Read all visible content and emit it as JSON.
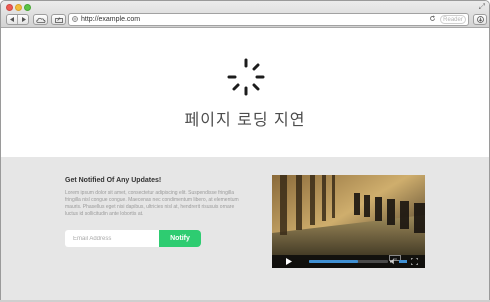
{
  "browser": {
    "url": "http://example.com",
    "reader_label": "Reader"
  },
  "hero": {
    "title": "페이지 로딩 지연"
  },
  "newsletter": {
    "title": "Get Notified Of Any Updates!",
    "description": "Lorem ipsum dolor sit amet, consectetur adipiscing elit. Suspendisse fringilla fringilla nisl congue congue. Maecenas nec condimentum libero, at elementum mauris. Phasellus eget nisi dapibus, ultricies nisl at, hendrerit risusuis ornare luctus id sollicitudin ante lobortis at.",
    "email_placeholder": "Email Address",
    "button_label": "Notify"
  },
  "video": {
    "progress": 0.62,
    "volume": 1.0
  },
  "colors": {
    "accent": "#2ecc71",
    "progress": "#3f8fd2"
  }
}
